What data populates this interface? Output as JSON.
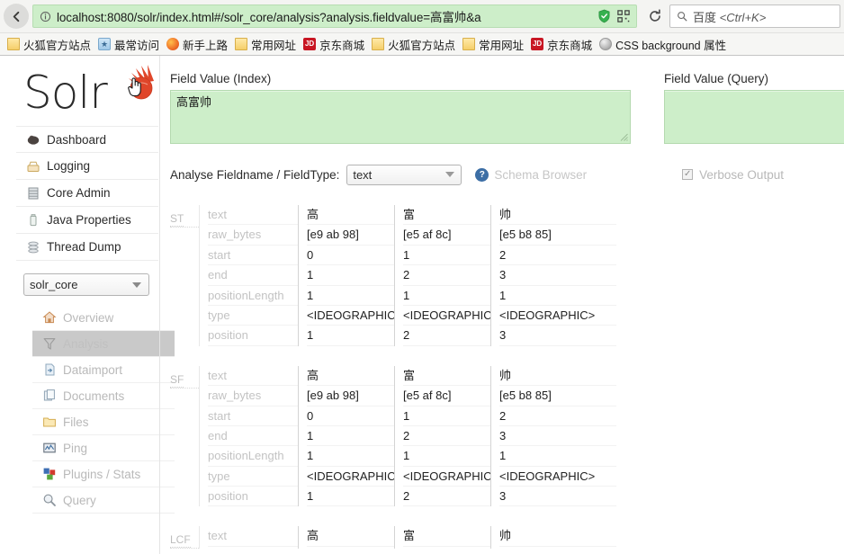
{
  "browser": {
    "back_icon": "back-arrow-icon",
    "identity_icon": "info-icon",
    "url_host": "localhost:8080",
    "url_rest": "/solr/index.html#/solr_core/analysis?analysis.fieldvalue=高富帅&a",
    "url_full": "localhost:8080/solr/index.html#/solr_core/analysis?analysis.fieldvalue=高富帅&a",
    "shield_icon": "shield-icon",
    "reader_icon": "qr-icon",
    "reload_icon": "reload-icon",
    "search_engine_icon": "search-icon",
    "search_engine": "百度",
    "search_shortcut": "<Ctrl+K>",
    "bookmarks": [
      {
        "label": "火狐官方站点",
        "icon": "folder-icon"
      },
      {
        "label": "最常访问",
        "icon": "most-visited-icon"
      },
      {
        "label": "新手上路",
        "icon": "firefox-icon"
      },
      {
        "label": "常用网址",
        "icon": "folder-icon"
      },
      {
        "label": "京东商城",
        "icon": "jd-icon"
      },
      {
        "label": "火狐官方站点",
        "icon": "folder-icon"
      },
      {
        "label": "常用网址",
        "icon": "folder-icon"
      },
      {
        "label": "京东商城",
        "icon": "jd-icon"
      },
      {
        "label": "CSS background 属性",
        "icon": "globe-icon"
      }
    ]
  },
  "sidebar": {
    "logo_text": "Solr",
    "logo_icon": "solr-sunburst-icon",
    "cursor_icon": "hand-pointer-cursor",
    "main_nav": [
      {
        "label": "Dashboard",
        "icon": "dashboard-icon"
      },
      {
        "label": "Logging",
        "icon": "logging-icon"
      },
      {
        "label": "Core Admin",
        "icon": "core-admin-icon"
      },
      {
        "label": "Java Properties",
        "icon": "java-properties-icon"
      },
      {
        "label": "Thread Dump",
        "icon": "thread-dump-icon"
      }
    ],
    "core_selector": {
      "value": "solr_core",
      "caret_icon": "chevron-down-icon"
    },
    "core_nav": [
      {
        "label": "Overview",
        "icon": "overview-home-icon",
        "selected": false
      },
      {
        "label": "Analysis",
        "icon": "analysis-funnel-icon",
        "selected": true
      },
      {
        "label": "Dataimport",
        "icon": "dataimport-icon",
        "selected": false
      },
      {
        "label": "Documents",
        "icon": "documents-icon",
        "selected": false
      },
      {
        "label": "Files",
        "icon": "files-folder-icon",
        "selected": false
      },
      {
        "label": "Ping",
        "icon": "ping-icon",
        "selected": false
      },
      {
        "label": "Plugins / Stats",
        "icon": "plugins-stats-icon",
        "selected": false
      },
      {
        "label": "Query",
        "icon": "query-magnifier-icon",
        "selected": false
      }
    ]
  },
  "main": {
    "index_field": {
      "label": "Field Value (Index)",
      "value": "高富帅",
      "placeholder": ""
    },
    "query_field": {
      "label": "Field Value (Query)",
      "value": "",
      "placeholder": ""
    },
    "analyse_label": "Analyse Fieldname / FieldType:",
    "fieldtype_select": {
      "value": "text",
      "caret_icon": "chevron-down-icon"
    },
    "schema_browser": {
      "label": "Schema Browser",
      "icon": "help-question-icon"
    },
    "verbose_output": {
      "label": "Verbose Output",
      "checked": true,
      "icon": "checkbox-checked-icon"
    },
    "analysis": {
      "attributes": [
        "text",
        "raw_bytes",
        "start",
        "end",
        "positionLength",
        "type",
        "position"
      ],
      "blocks": [
        {
          "abbr": "ST",
          "tokens": [
            {
              "text": "高",
              "raw_bytes": "[e9 ab 98]",
              "start": "0",
              "end": "1",
              "positionLength": "1",
              "type": "<IDEOGRAPHIC>",
              "position": "1"
            },
            {
              "text": "富",
              "raw_bytes": "[e5 af 8c]",
              "start": "1",
              "end": "2",
              "positionLength": "1",
              "type": "<IDEOGRAPHIC>",
              "position": "2"
            },
            {
              "text": "帅",
              "raw_bytes": "[e5 b8 85]",
              "start": "2",
              "end": "3",
              "positionLength": "1",
              "type": "<IDEOGRAPHIC>",
              "position": "3"
            }
          ]
        },
        {
          "abbr": "SF",
          "tokens": [
            {
              "text": "高",
              "raw_bytes": "[e9 ab 98]",
              "start": "0",
              "end": "1",
              "positionLength": "1",
              "type": "<IDEOGRAPHIC>",
              "position": "1"
            },
            {
              "text": "富",
              "raw_bytes": "[e5 af 8c]",
              "start": "1",
              "end": "2",
              "positionLength": "1",
              "type": "<IDEOGRAPHIC>",
              "position": "2"
            },
            {
              "text": "帅",
              "raw_bytes": "[e5 b8 85]",
              "start": "2",
              "end": "3",
              "positionLength": "1",
              "type": "<IDEOGRAPHIC>",
              "position": "3"
            }
          ]
        },
        {
          "abbr": "LCF",
          "tokens": [
            {
              "text": "高"
            },
            {
              "text": "富"
            },
            {
              "text": "帅"
            }
          ]
        }
      ]
    }
  }
}
